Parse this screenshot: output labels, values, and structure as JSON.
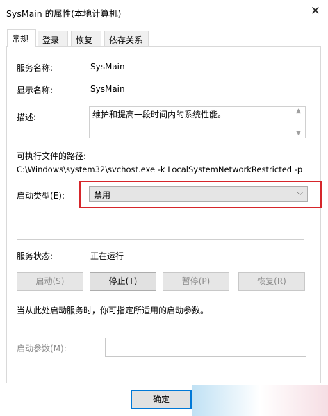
{
  "window": {
    "title": "SysMain 的属性(本地计算机)",
    "close_glyph": "✕"
  },
  "tabs": [
    {
      "label": "常规"
    },
    {
      "label": "登录"
    },
    {
      "label": "恢复"
    },
    {
      "label": "依存关系"
    }
  ],
  "general": {
    "service_name_label": "服务名称:",
    "service_name": "SysMain",
    "display_name_label": "显示名称:",
    "display_name": "SysMain",
    "description_label": "描述:",
    "description": "维护和提高一段时间内的系统性能。",
    "path_label": "可执行文件的路径:",
    "path": "C:\\Windows\\system32\\svchost.exe -k LocalSystemNetworkRestricted -p",
    "startup_type_label": "启动类型(E):",
    "startup_type": "禁用",
    "status_label": "服务状态:",
    "status": "正在运行",
    "buttons": {
      "start": "启动(S)",
      "stop": "停止(T)",
      "pause": "暂停(P)",
      "resume": "恢复(R)"
    },
    "hint": "当从此处启动服务时，你可指定所适用的启动参数。",
    "params_label": "启动参数(M):",
    "params_value": ""
  },
  "footer": {
    "ok": "确定"
  },
  "colors": {
    "highlight": "#d6262b",
    "ok_border": "#0078d7"
  }
}
